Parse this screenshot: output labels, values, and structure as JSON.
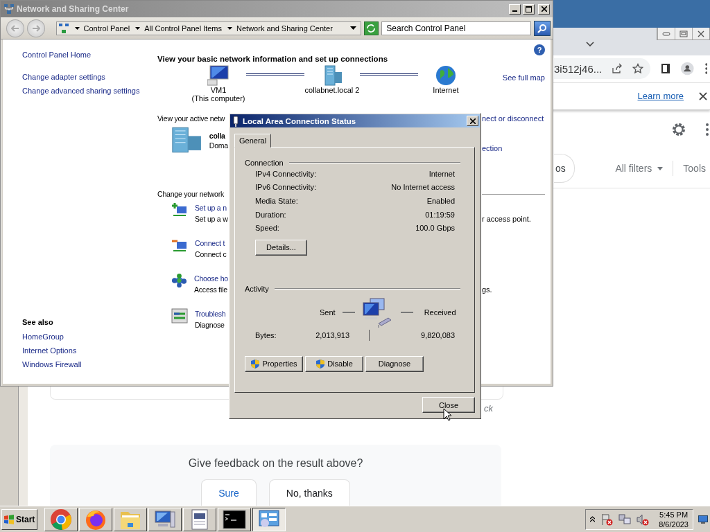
{
  "browser": {
    "address_fragment": "3i512j46...",
    "infobar_link": "Learn more",
    "filter_chip": "os",
    "filters": [
      "All filters",
      "Tools"
    ],
    "result_fragment": "ck",
    "feedback": {
      "question": "Give feedback on the result above?",
      "buttons": [
        "Sure",
        "No, thanks"
      ]
    }
  },
  "control_panel": {
    "title": "Network and Sharing Center",
    "breadcrumb": [
      "Control Panel",
      "All Control Panel Items",
      "Network and Sharing Center"
    ],
    "search": {
      "placeholder": "Search Control Panel"
    },
    "sidebar": {
      "links": [
        "Control Panel Home",
        "Change adapter settings",
        "Change advanced sharing settings"
      ],
      "see_also": {
        "heading": "See also",
        "links": [
          "HomeGroup",
          "Internet Options",
          "Windows Firewall"
        ]
      }
    },
    "heading": "View your basic network information and set up connections",
    "help": "?",
    "map": {
      "nodes": [
        {
          "kind": "computer",
          "name": "VM1",
          "sub": "(This computer)"
        },
        {
          "kind": "server",
          "name": "collabnet.local  2"
        },
        {
          "kind": "globe",
          "name": "Internet"
        }
      ],
      "full_map_link": "See full map"
    },
    "active": {
      "label": "View your active netw",
      "link_fragment": "nect or disconnect",
      "name": "colla",
      "type": "Doma",
      "connection_fragment": "ection"
    },
    "change": {
      "label": "Change your network",
      "tasks": [
        {
          "kind": "setup",
          "title": "Set up a n",
          "desc": "Set up a w",
          "desc_fragment": "r access point."
        },
        {
          "kind": "connect",
          "title": "Connect t",
          "desc": "Connect c"
        },
        {
          "kind": "homegroup",
          "title": "Choose ho",
          "desc": "Access file",
          "desc_fragment": "gs."
        },
        {
          "kind": "troubleshoot",
          "title": "Troublesh",
          "desc": "Diagnose"
        }
      ]
    }
  },
  "dialog": {
    "title": "Local Area Connection Status",
    "tabs": [
      {
        "label": "General",
        "selected": true
      }
    ],
    "connection": {
      "heading": "Connection",
      "rows": [
        {
          "label": "IPv4 Connectivity:",
          "value": "Internet"
        },
        {
          "label": "IPv6 Connectivity:",
          "value": "No Internet access"
        },
        {
          "label": "Media State:",
          "value": "Enabled"
        },
        {
          "label": "Duration:",
          "value": "01:19:59"
        },
        {
          "label": "Speed:",
          "value": "100.0 Gbps"
        }
      ],
      "details_button": "Details..."
    },
    "activity": {
      "heading": "Activity",
      "sent": "Sent",
      "received": "Received",
      "bytes_label": "Bytes:",
      "bytes_sent": "2,013,913",
      "bytes_received": "9,820,083"
    },
    "buttons": [
      {
        "label": "Properties",
        "shield": true
      },
      {
        "label": "Disable",
        "shield": true
      },
      {
        "label": "Diagnose",
        "shield": false
      }
    ],
    "close_button": "Close"
  },
  "taskbar": {
    "start": "Start",
    "apps": [
      {
        "kind": "chrome",
        "selected": false
      },
      {
        "kind": "firefox",
        "selected": false
      },
      {
        "kind": "explorer",
        "selected": false
      },
      {
        "kind": "computer",
        "selected": false
      },
      {
        "kind": "notepad",
        "selected": false
      },
      {
        "kind": "terminal",
        "selected": false
      },
      {
        "kind": "control_panel",
        "selected": true
      }
    ],
    "clock": {
      "time": "5:45 PM",
      "date": "8/6/2023"
    }
  }
}
